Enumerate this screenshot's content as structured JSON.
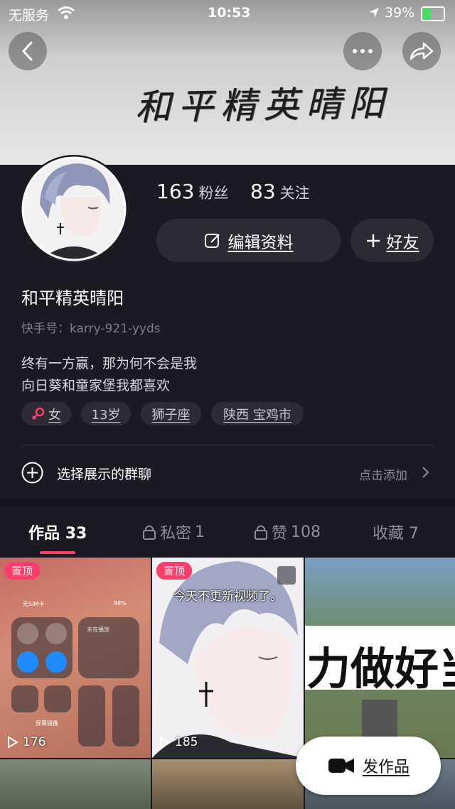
{
  "status_bar": {
    "carrier": "无服务",
    "time": "10:53",
    "battery": "39%"
  },
  "banner": {
    "text": "和平精英晴阳"
  },
  "stats": {
    "fans_count": "163",
    "fans_label": "粉丝",
    "following_count": "83",
    "following_label": "关注"
  },
  "actions": {
    "edit_label": "编辑资料",
    "friend_label": "好友"
  },
  "profile": {
    "name": "和平精英晴阳",
    "kuaishou_id": "快手号：karry-921-yyds",
    "bio_line1": "终有一方赢，那为何不会是我",
    "bio_line2": "向日葵和童家堡我都喜欢"
  },
  "tags": {
    "gender": "女",
    "age": "13岁",
    "zodiac": "狮子座",
    "location": "陕西 宝鸡市"
  },
  "group_chat": {
    "label": "选择展示的群聊",
    "action": "点击添加"
  },
  "tabs": [
    {
      "label": "作品",
      "count": "33"
    },
    {
      "label": "私密",
      "count": "1"
    },
    {
      "label": "赞",
      "count": "108"
    },
    {
      "label": "收藏",
      "count": "7"
    }
  ],
  "videos": [
    {
      "pinned": "置顶",
      "plays": "176"
    },
    {
      "pinned": "置顶",
      "plays": "185",
      "caption": "今天不更新视频了。"
    },
    {
      "caption": "力做好当"
    }
  ],
  "thumb1_ui": {
    "sim": "无SIM卡",
    "battery": "98%",
    "now_playing": "未在播放",
    "mirror": "屏幕镜像"
  },
  "fab": {
    "label": "发作品"
  },
  "colors": {
    "accent": "#ff3d6a",
    "background": "#1b1a23"
  }
}
